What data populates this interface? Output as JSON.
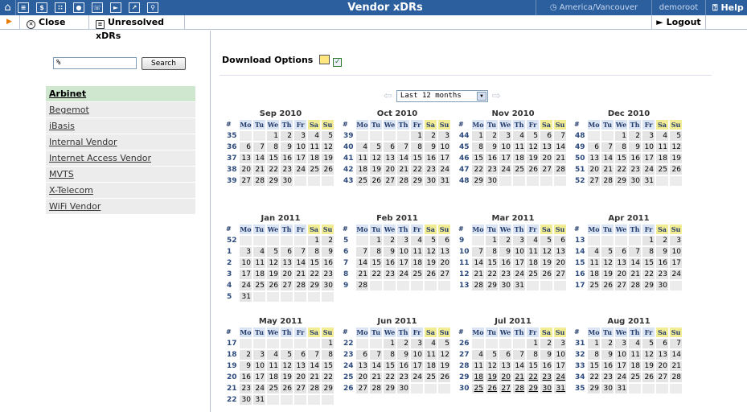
{
  "window": {
    "title": "Vendor xDRs",
    "timezone": "America/Vancouver",
    "user": "demoroot",
    "help": "Help"
  },
  "topnav": {
    "icons": [
      "home-icon",
      "list-icon",
      "dollar-icon",
      "grid-icon",
      "person-icon",
      "phone-icon",
      "play-icon",
      "chart-icon",
      "magnifier-icon"
    ]
  },
  "toolbar": {
    "close_label": "Close",
    "unresolved_label": "Unresolved xDRs",
    "logout_label": "Logout"
  },
  "search": {
    "value": "%",
    "button": "Search"
  },
  "vendors": [
    "Arbinet",
    "Begemot",
    "iBasis",
    "Internal Vendor",
    "Internet Access Vendor",
    "MVTS",
    "X-Telecom",
    "WiFi Vendor"
  ],
  "selected_vendor": "Arbinet",
  "download_label": "Download Options",
  "period": {
    "value": "Last 12 months"
  },
  "weekdays": [
    "Mo",
    "Tu",
    "We",
    "Th",
    "Fr",
    "Sa",
    "Su"
  ],
  "week_header": "#",
  "colors": {
    "topbar": "#2c5f9e",
    "selected": "#cfe7cf",
    "weekend_header": "#f2ec95",
    "weekday_header": "#dbe4f3"
  },
  "months": [
    {
      "title": "Sep 2010",
      "rows": [
        {
          "wk": "35",
          "days": [
            "",
            "",
            "1",
            "2",
            "3",
            "4",
            "5"
          ]
        },
        {
          "wk": "36",
          "days": [
            "6",
            "7",
            "8",
            "9",
            "10",
            "11",
            "12"
          ]
        },
        {
          "wk": "37",
          "days": [
            "13",
            "14",
            "15",
            "16",
            "17",
            "18",
            "19"
          ]
        },
        {
          "wk": "38",
          "days": [
            "20",
            "21",
            "22",
            "23",
            "24",
            "25",
            "26"
          ]
        },
        {
          "wk": "39",
          "days": [
            "27",
            "28",
            "29",
            "30",
            "",
            "",
            ""
          ]
        }
      ]
    },
    {
      "title": "Oct 2010",
      "rows": [
        {
          "wk": "39",
          "days": [
            "",
            "",
            "",
            "",
            "1",
            "2",
            "3"
          ]
        },
        {
          "wk": "40",
          "days": [
            "4",
            "5",
            "6",
            "7",
            "8",
            "9",
            "10"
          ]
        },
        {
          "wk": "41",
          "days": [
            "11",
            "12",
            "13",
            "14",
            "15",
            "16",
            "17"
          ]
        },
        {
          "wk": "42",
          "days": [
            "18",
            "19",
            "20",
            "21",
            "22",
            "23",
            "24"
          ]
        },
        {
          "wk": "43",
          "days": [
            "25",
            "26",
            "27",
            "28",
            "29",
            "30",
            "31"
          ]
        }
      ]
    },
    {
      "title": "Nov 2010",
      "rows": [
        {
          "wk": "44",
          "days": [
            "1",
            "2",
            "3",
            "4",
            "5",
            "6",
            "7"
          ]
        },
        {
          "wk": "45",
          "days": [
            "8",
            "9",
            "10",
            "11",
            "12",
            "13",
            "14"
          ]
        },
        {
          "wk": "46",
          "days": [
            "15",
            "16",
            "17",
            "18",
            "19",
            "20",
            "21"
          ]
        },
        {
          "wk": "47",
          "days": [
            "22",
            "23",
            "24",
            "25",
            "26",
            "27",
            "28"
          ]
        },
        {
          "wk": "48",
          "days": [
            "29",
            "30",
            "",
            "",
            "",
            "",
            ""
          ]
        }
      ]
    },
    {
      "title": "Dec 2010",
      "rows": [
        {
          "wk": "48",
          "days": [
            "",
            "",
            "1",
            "2",
            "3",
            "4",
            "5"
          ]
        },
        {
          "wk": "49",
          "days": [
            "6",
            "7",
            "8",
            "9",
            "10",
            "11",
            "12"
          ]
        },
        {
          "wk": "50",
          "days": [
            "13",
            "14",
            "15",
            "16",
            "17",
            "18",
            "19"
          ]
        },
        {
          "wk": "51",
          "days": [
            "20",
            "21",
            "22",
            "23",
            "24",
            "25",
            "26"
          ]
        },
        {
          "wk": "52",
          "days": [
            "27",
            "28",
            "29",
            "30",
            "31",
            "",
            ""
          ]
        }
      ]
    },
    {
      "title": "Jan 2011",
      "rows": [
        {
          "wk": "52",
          "days": [
            "",
            "",
            "",
            "",
            "",
            "1",
            "2"
          ]
        },
        {
          "wk": "1",
          "days": [
            "3",
            "4",
            "5",
            "6",
            "7",
            "8",
            "9"
          ]
        },
        {
          "wk": "2",
          "days": [
            "10",
            "11",
            "12",
            "13",
            "14",
            "15",
            "16"
          ]
        },
        {
          "wk": "3",
          "days": [
            "17",
            "18",
            "19",
            "20",
            "21",
            "22",
            "23"
          ]
        },
        {
          "wk": "4",
          "days": [
            "24",
            "25",
            "26",
            "27",
            "28",
            "29",
            "30"
          ]
        },
        {
          "wk": "5",
          "days": [
            "31",
            "",
            "",
            "",
            "",
            "",
            ""
          ]
        }
      ]
    },
    {
      "title": "Feb 2011",
      "rows": [
        {
          "wk": "5",
          "days": [
            "",
            "1",
            "2",
            "3",
            "4",
            "5",
            "6"
          ]
        },
        {
          "wk": "6",
          "days": [
            "7",
            "8",
            "9",
            "10",
            "11",
            "12",
            "13"
          ]
        },
        {
          "wk": "7",
          "days": [
            "14",
            "15",
            "16",
            "17",
            "18",
            "19",
            "20"
          ]
        },
        {
          "wk": "8",
          "days": [
            "21",
            "22",
            "23",
            "24",
            "25",
            "26",
            "27"
          ]
        },
        {
          "wk": "9",
          "days": [
            "28",
            "",
            "",
            "",
            "",
            "",
            ""
          ]
        }
      ]
    },
    {
      "title": "Mar 2011",
      "rows": [
        {
          "wk": "9",
          "days": [
            "",
            "1",
            "2",
            "3",
            "4",
            "5",
            "6"
          ]
        },
        {
          "wk": "10",
          "days": [
            "7",
            "8",
            "9",
            "10",
            "11",
            "12",
            "13"
          ]
        },
        {
          "wk": "11",
          "days": [
            "14",
            "15",
            "16",
            "17",
            "18",
            "19",
            "20"
          ]
        },
        {
          "wk": "12",
          "days": [
            "21",
            "22",
            "23",
            "24",
            "25",
            "26",
            "27"
          ]
        },
        {
          "wk": "13",
          "days": [
            "28",
            "29",
            "30",
            "31",
            "",
            "",
            ""
          ]
        }
      ]
    },
    {
      "title": "Apr 2011",
      "rows": [
        {
          "wk": "13",
          "days": [
            "",
            "",
            "",
            "",
            "1",
            "2",
            "3"
          ]
        },
        {
          "wk": "14",
          "days": [
            "4",
            "5",
            "6",
            "7",
            "8",
            "9",
            "10"
          ]
        },
        {
          "wk": "15",
          "days": [
            "11",
            "12",
            "13",
            "14",
            "15",
            "16",
            "17"
          ]
        },
        {
          "wk": "16",
          "days": [
            "18",
            "19",
            "20",
            "21",
            "22",
            "23",
            "24"
          ]
        },
        {
          "wk": "17",
          "days": [
            "25",
            "26",
            "27",
            "28",
            "29",
            "30",
            ""
          ]
        }
      ]
    },
    {
      "title": "May 2011",
      "rows": [
        {
          "wk": "17",
          "days": [
            "",
            "",
            "",
            "",
            "",
            "",
            "1"
          ]
        },
        {
          "wk": "18",
          "days": [
            "2",
            "3",
            "4",
            "5",
            "6",
            "7",
            "8"
          ]
        },
        {
          "wk": "19",
          "days": [
            "9",
            "10",
            "11",
            "12",
            "13",
            "14",
            "15"
          ]
        },
        {
          "wk": "20",
          "days": [
            "16",
            "17",
            "18",
            "19",
            "20",
            "21",
            "22"
          ]
        },
        {
          "wk": "21",
          "days": [
            "23",
            "24",
            "25",
            "26",
            "27",
            "28",
            "29"
          ]
        },
        {
          "wk": "22",
          "days": [
            "30",
            "31",
            "",
            "",
            "",
            "",
            ""
          ]
        }
      ]
    },
    {
      "title": "Jun 2011",
      "rows": [
        {
          "wk": "22",
          "days": [
            "",
            "",
            "1",
            "2",
            "3",
            "4",
            "5"
          ]
        },
        {
          "wk": "23",
          "days": [
            "6",
            "7",
            "8",
            "9",
            "10",
            "11",
            "12"
          ]
        },
        {
          "wk": "24",
          "days": [
            "13",
            "14",
            "15",
            "16",
            "17",
            "18",
            "19"
          ]
        },
        {
          "wk": "25",
          "days": [
            "20",
            "21",
            "22",
            "23",
            "24",
            "25",
            "26"
          ]
        },
        {
          "wk": "26",
          "days": [
            "27",
            "28",
            "29",
            "30",
            "",
            "",
            ""
          ]
        }
      ]
    },
    {
      "title": "Jul 2011",
      "rows": [
        {
          "wk": "26",
          "days": [
            "",
            "",
            "",
            "",
            "1",
            "2",
            "3"
          ]
        },
        {
          "wk": "27",
          "days": [
            "4",
            "5",
            "6",
            "7",
            "8",
            "9",
            "10"
          ]
        },
        {
          "wk": "28",
          "days": [
            "11",
            "12",
            "13",
            "14",
            "15",
            "16",
            "17"
          ]
        },
        {
          "wk": "29",
          "days": [
            "18",
            "19",
            "20",
            "21",
            "22",
            "23",
            "24"
          ],
          "linked": true
        },
        {
          "wk": "30",
          "days": [
            "25",
            "26",
            "27",
            "28",
            "29",
            "30",
            "31"
          ],
          "linked": true
        }
      ]
    },
    {
      "title": "Aug 2011",
      "rows": [
        {
          "wk": "31",
          "days": [
            "1",
            "2",
            "3",
            "4",
            "5",
            "6",
            "7"
          ]
        },
        {
          "wk": "32",
          "days": [
            "8",
            "9",
            "10",
            "11",
            "12",
            "13",
            "14"
          ]
        },
        {
          "wk": "33",
          "days": [
            "15",
            "16",
            "17",
            "18",
            "19",
            "20",
            "21"
          ]
        },
        {
          "wk": "34",
          "days": [
            "22",
            "23",
            "24",
            "25",
            "26",
            "27",
            "28"
          ]
        },
        {
          "wk": "35",
          "days": [
            "29",
            "30",
            "31",
            "",
            "",
            "",
            ""
          ]
        }
      ]
    }
  ]
}
